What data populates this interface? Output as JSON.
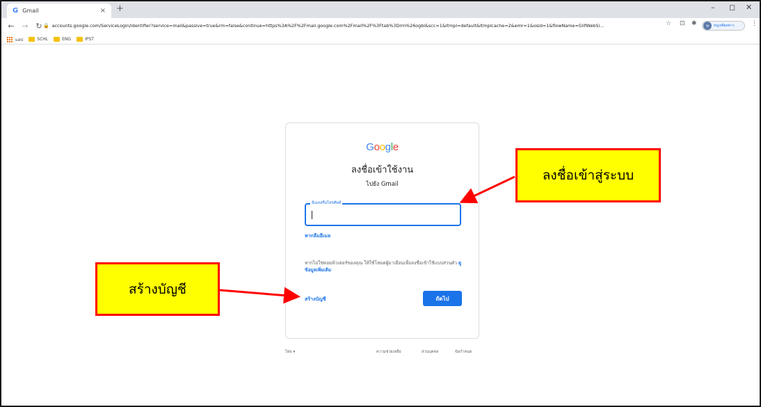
{
  "browser": {
    "tab_favicon": "G",
    "tab_title": "Gmail",
    "tab_close": "×",
    "new_tab": "+",
    "window_controls": [
      "–",
      "◻",
      "✕"
    ],
    "url": "accounts.google.com/ServiceLogin/identifier?service=mail&passive=true&rm=false&continue=https%3A%2F%2Fmail.google.com%2Fmail%2F%3Ftab%3Drm%26ogbl&scc=1&ltmpl=default&ltmplcache=2&emr=1&osid=1&flowName=GlifWebSi...",
    "profile_name": "หนูเหยียดทาว",
    "profile_initial": "ห"
  },
  "bookmarks": {
    "apps": "แอป",
    "items": [
      "SCHL",
      "ENG",
      "IPST"
    ]
  },
  "signin": {
    "logo_letters": [
      "G",
      "o",
      "o",
      "g",
      "l",
      "e"
    ],
    "title": "ลงชื่อเข้าใช้งาน",
    "subtitle": "ไปยัง Gmail",
    "email_label": "อีเมลหรือโทรศัพท์",
    "forgot_email": "หากลืมอีเมล",
    "guest_text": "หากไม่ใช่คอมพิวเตอร์ของคุณ ให้ใช้โหมดผู้มาเยือนเพื่อลงชื่อเข้าใช้แบบส่วนตัว",
    "learn_more": "ดูข้อมูลเพิ่มเติม",
    "create_account": "สร้างบัญชี",
    "next_button": "ถัดไป"
  },
  "footer": {
    "language": "ไทย ▾",
    "help": "ความช่วยเหลือ",
    "privacy": "ส่วนบุคคล",
    "terms": "ข้อกำหนด"
  },
  "annotations": {
    "signin_callout": "ลงชื่อเข้าสู่ระบบ",
    "create_callout": "สร้างบัญชี"
  },
  "colors": {
    "accent": "#1a73e8",
    "callout_fill": "#ffff00",
    "callout_border": "#ff0000",
    "google_blue": "#4285f4",
    "google_red": "#ea4335",
    "google_yellow": "#fbbc05",
    "google_green": "#34a853"
  }
}
